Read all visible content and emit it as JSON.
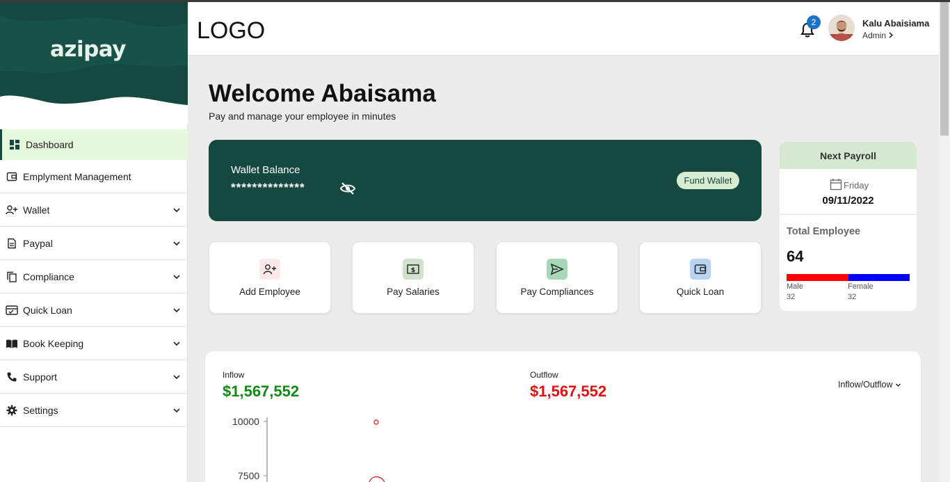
{
  "brand": {
    "name": "azipay"
  },
  "sidebar": {
    "items": [
      {
        "label": "Dashboard",
        "icon": "dashboard-icon",
        "active": true
      },
      {
        "label": "Emplyment Management",
        "icon": "wallet-card-icon"
      },
      {
        "label": "Wallet",
        "icon": "add-user-icon"
      },
      {
        "label": "Paypal",
        "icon": "document-icon"
      },
      {
        "label": "Compliance",
        "icon": "copy-icon"
      },
      {
        "label": "Quick Loan",
        "icon": "checklist-icon"
      },
      {
        "label": "Book Keeping",
        "icon": "book-icon"
      },
      {
        "label": "Support",
        "icon": "phone-icon"
      },
      {
        "label": "Settings",
        "icon": "gear-icon"
      }
    ]
  },
  "header": {
    "logo": "LOGO",
    "notifications_count": "2",
    "user_name": "Kalu Abaisiama",
    "user_role": "Admin"
  },
  "main": {
    "welcome": "Welcome Abaisama",
    "subtitle": "Pay and manage your employee in minutes",
    "wallet": {
      "label": "Wallet Balance",
      "masked_value": "**************",
      "fund_button": "Fund Wallet"
    },
    "actions": [
      {
        "label": "Add Employee",
        "icon": "add-user-icon",
        "bg": "#fde8ea"
      },
      {
        "label": "Pay Salaries",
        "icon": "money-icon",
        "bg": "#cfe3cc"
      },
      {
        "label": "Pay Compliances",
        "icon": "send-icon",
        "bg": "#a7d9b8"
      },
      {
        "label": "Quick Loan",
        "icon": "wallet-icon",
        "bg": "#b9d3f2"
      }
    ],
    "payroll": {
      "title": "Next Payroll",
      "day": "Friday",
      "date": "09/11/2022",
      "total_label": "Total Employee",
      "total": "64",
      "male_label": "Male",
      "male_count": "32",
      "female_label": "Female",
      "female_count": "32",
      "male_fraction": 0.5
    },
    "flow": {
      "inflow_label": "Inflow",
      "inflow_value": "$1,567,552",
      "outflow_label": "Outflow",
      "outflow_value": "$1,567,552",
      "selector": "Inflow/Outflow"
    }
  },
  "chart_data": {
    "type": "scatter",
    "y_ticks": [
      "10000",
      "7500"
    ],
    "series": [
      {
        "values": [
          10000
        ]
      }
    ],
    "colors": {
      "inflow": "#118a17",
      "outflow": "#e21111"
    }
  }
}
